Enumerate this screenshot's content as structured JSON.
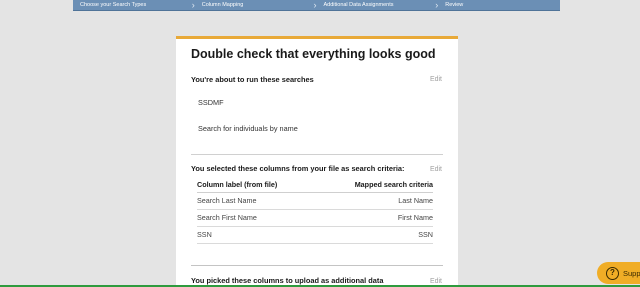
{
  "steps": [
    {
      "label": "Choose your Search Types"
    },
    {
      "label": "Column Mapping"
    },
    {
      "label": "Additional Data Assignments"
    },
    {
      "label": "Review"
    }
  ],
  "card": {
    "title": "Double check that everything looks good",
    "edit_label": "Edit",
    "searches_section": {
      "title": "You're about to run these searches",
      "items": [
        "SSDMF",
        "Search for individuals by name"
      ]
    },
    "criteria_section": {
      "title": "You selected these columns from your file as search criteria:",
      "col1_header": "Column label (from file)",
      "col2_header": "Mapped search criteria",
      "rows": [
        {
          "file_label": "Search Last Name",
          "criteria": "Last Name"
        },
        {
          "file_label": "Search First Name",
          "criteria": "First Name"
        },
        {
          "file_label": "SSN",
          "criteria": "SSN"
        }
      ]
    },
    "additional_section": {
      "title": "You picked these columns to upload as additional data"
    }
  },
  "support": {
    "label": "Supp",
    "icon": "question-icon"
  },
  "colors": {
    "accent": "#e8a938",
    "steps_bar": "#6b8fb5",
    "support": "#f0ad26"
  }
}
